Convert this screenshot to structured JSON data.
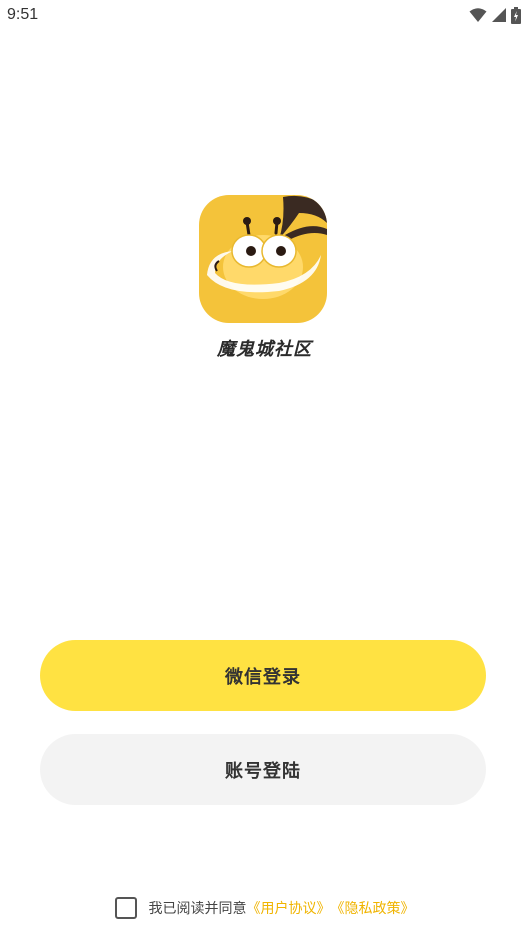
{
  "status_bar": {
    "time": "9:51",
    "icons": [
      "wifi-icon",
      "signal-icon",
      "battery-icon"
    ]
  },
  "app": {
    "name": "魔鬼城社区",
    "logo_icon": "bee-mascot-logo"
  },
  "buttons": {
    "wechat_login": "微信登录",
    "account_login": "账号登陆"
  },
  "agreement": {
    "prefix": "我已阅读并同意",
    "user_agreement": "《用户协议》",
    "privacy_policy": "《隐私政策》",
    "checked": false
  },
  "colors": {
    "primary_yellow": "#ffe242",
    "secondary_gray": "#f3f3f3",
    "link_color": "#f0b400",
    "logo_bg": "#f4c33a"
  }
}
